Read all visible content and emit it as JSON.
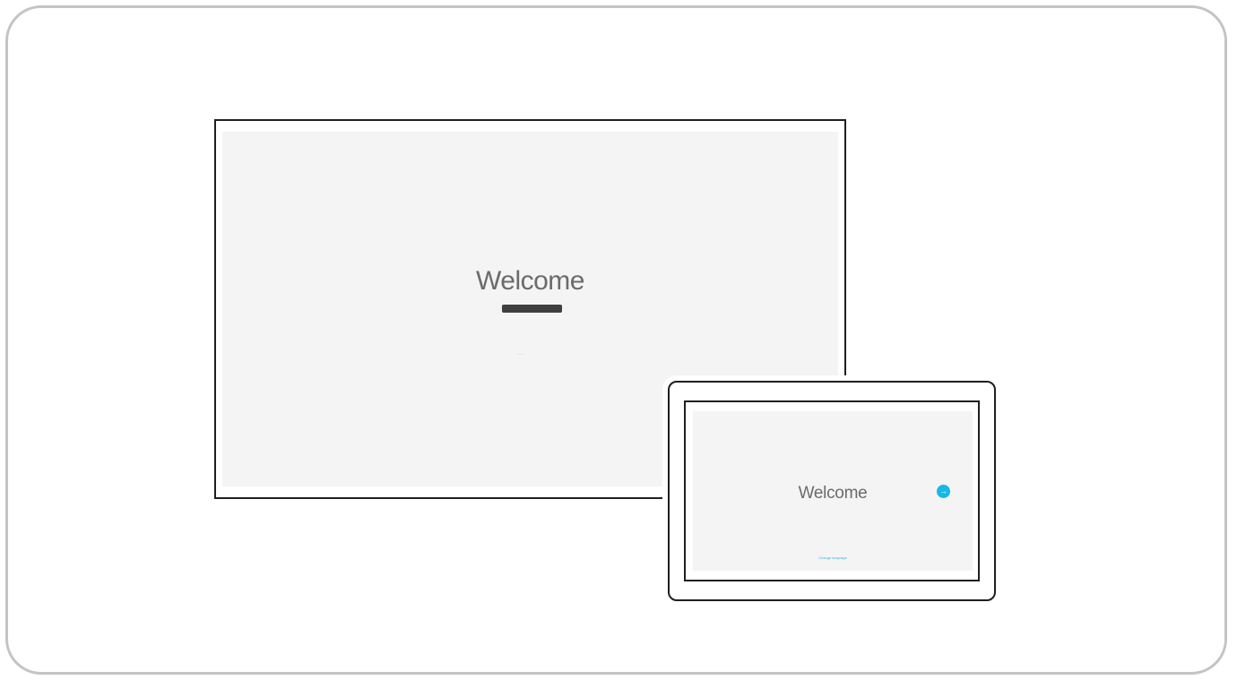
{
  "display": {
    "welcome_text": "Welcome"
  },
  "touch_panel": {
    "welcome_text": "Welcome",
    "next_button_icon": "arrow-right-icon",
    "next_button_glyph": "→",
    "change_language_label": "Change language",
    "accent_color": "#16b8e6"
  }
}
